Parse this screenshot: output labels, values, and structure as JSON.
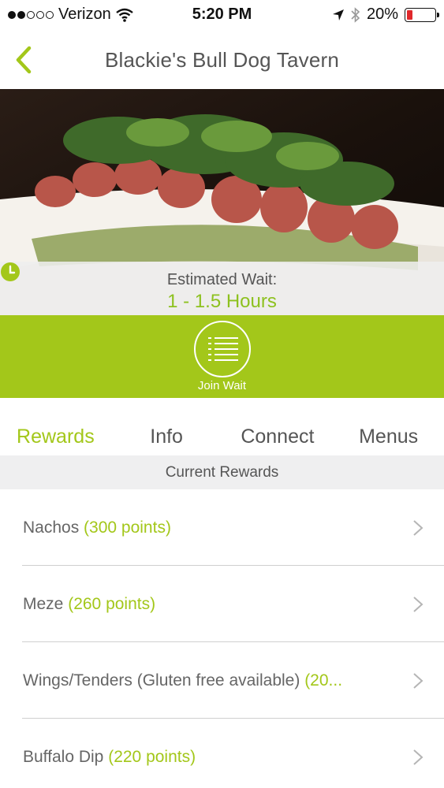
{
  "status_bar": {
    "carrier": "Verizon",
    "time": "5:20 PM",
    "battery_percent": "20%",
    "battery_level": 0.2,
    "battery_color": "#e0282b",
    "signal_bars_filled": 2,
    "signal_bars_total": 5
  },
  "nav": {
    "title": "Blackie's Bull Dog Tavern",
    "back_icon": "chevron-left-icon"
  },
  "hero": {
    "wait_label": "Estimated Wait:",
    "wait_value": "1 - 1.5 Hours",
    "clock_icon": "clock-icon"
  },
  "join_wait": {
    "label": "Join Wait",
    "icon": "list-icon"
  },
  "tabs": [
    {
      "label": "Rewards",
      "active": true
    },
    {
      "label": "Info",
      "active": false
    },
    {
      "label": "Connect",
      "active": false
    },
    {
      "label": "Menus",
      "active": false
    }
  ],
  "section_header": "Current Rewards",
  "rewards": [
    {
      "name": "Nachos",
      "points": "(300 points)"
    },
    {
      "name": "Meze",
      "points": "(260 points)"
    },
    {
      "name": "Wings/Tenders (Gluten free available)",
      "points": "(20..."
    },
    {
      "name": "Buffalo Dip",
      "points": "(220 points)"
    }
  ],
  "colors": {
    "accent": "#a3c71a",
    "text": "#555555",
    "section_bg": "#efeff0"
  }
}
